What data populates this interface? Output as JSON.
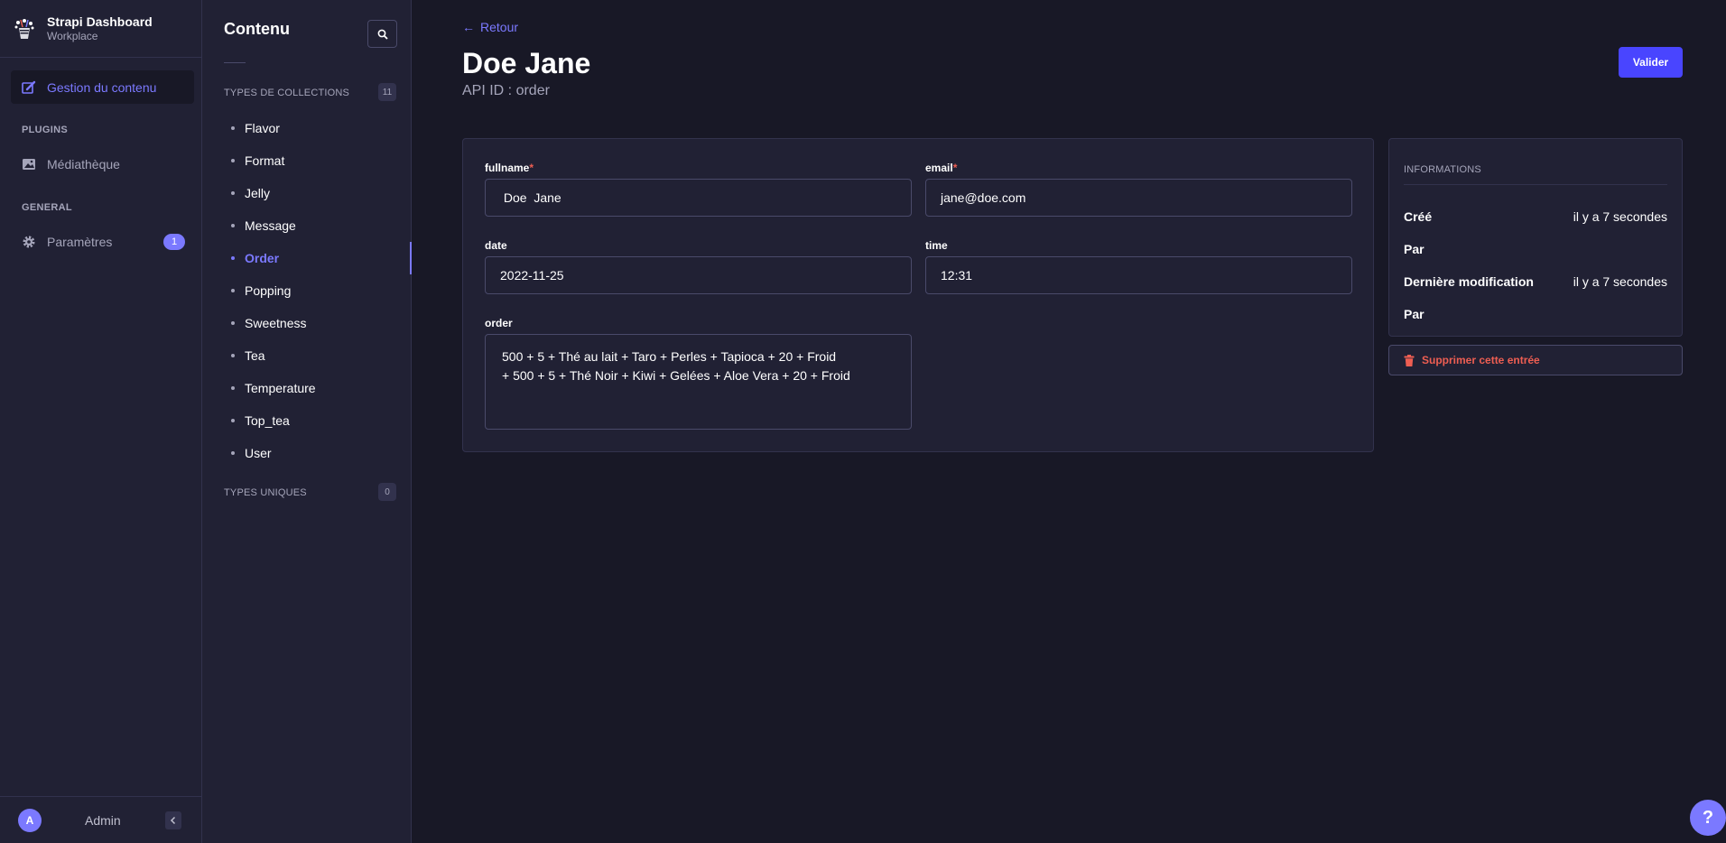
{
  "brand": {
    "title": "Strapi Dashboard",
    "subtitle": "Workplace"
  },
  "mainnav": {
    "content_manager": "Gestion du contenu",
    "plugins_heading": "PLUGINS",
    "media_library": "Médiathèque",
    "general_heading": "GENERAL",
    "settings": "Paramètres",
    "settings_badge": "1"
  },
  "user": {
    "initial": "A",
    "name": "Admin"
  },
  "subnav": {
    "title": "Contenu",
    "collections_heading": "TYPES DE COLLECTIONS",
    "collections_count": "11",
    "collections": [
      "Flavor",
      "Format",
      "Jelly",
      "Message",
      "Order",
      "Popping",
      "Sweetness",
      "Tea",
      "Temperature",
      "Top_tea",
      "User"
    ],
    "active_collection": "Order",
    "single_types_heading": "TYPES UNIQUES",
    "single_types_count": "0"
  },
  "header": {
    "back_label": "Retour",
    "title": "Doe Jane",
    "api_id": "API ID : order",
    "validate_label": "Valider"
  },
  "form": {
    "fullname": {
      "label": "fullname",
      "required_mark": "*",
      "value": " Doe  Jane"
    },
    "email": {
      "label": "email",
      "required_mark": "*",
      "value": "jane@doe.com"
    },
    "date": {
      "label": "date",
      "value": "2022-11-25"
    },
    "time": {
      "label": "time",
      "value": "12:31"
    },
    "order": {
      "label": "order",
      "value": "500 + 5 + Thé au lait + Taro + Perles + Tapioca + 20 + Froid\n+ 500 + 5 + Thé Noir + Kiwi + Gelées + Aloe Vera + 20 + Froid"
    }
  },
  "info": {
    "heading": "INFORMATIONS",
    "created_label": "Créé",
    "created_value": "il y a 7 secondes",
    "by_label": "Par",
    "modified_label": "Dernière modification",
    "modified_value": "il y a 7 secondes",
    "by_label_2": "Par"
  },
  "delete_label": "Supprimer cette entrée",
  "help_label": "?",
  "colors": {
    "background": "#181826",
    "panel": "#212134",
    "accent": "#7b79ff",
    "primary_button": "#4945ff",
    "danger": "#ee5e52"
  }
}
